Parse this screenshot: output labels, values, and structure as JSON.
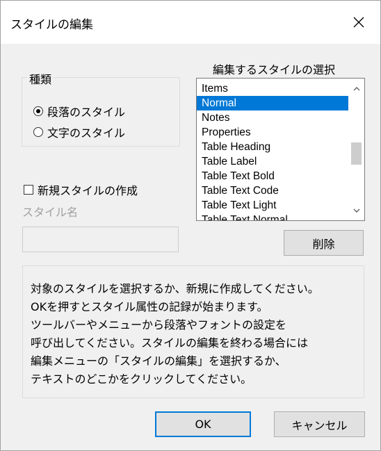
{
  "window": {
    "title": "スタイルの編集",
    "close_icon": "close-icon"
  },
  "kind_group": {
    "caption": "種類",
    "options": [
      {
        "label": "段落のスタイル",
        "checked": true
      },
      {
        "label": "文字のスタイル",
        "checked": false
      }
    ]
  },
  "new_style": {
    "checkbox_label": "新規スタイルの作成",
    "checked": false,
    "name_label": "スタイル名",
    "name_value": ""
  },
  "style_list": {
    "title": "編集するスタイルの選択",
    "items": [
      "Items",
      "Normal",
      "Notes",
      "Properties",
      "Table Heading",
      "Table Label",
      "Table Text Bold",
      "Table Text Code",
      "Table Text Light",
      "Table Text Normal"
    ],
    "selected": "Normal",
    "scroll_up_icon": "chevron-up-icon",
    "scroll_down_icon": "chevron-down-icon"
  },
  "buttons": {
    "delete": "削除",
    "ok": "OK",
    "cancel": "キャンセル"
  },
  "info": {
    "lines": [
      "対象のスタイルを選択するか、新規に作成してください。",
      "OKを押すとスタイル属性の記録が始まります。",
      "ツールバーやメニューから段落やフォントの設定を",
      "呼び出してください。スタイルの編集を終わる場合には",
      "編集メニューの「スタイルの編集」を選択するか、",
      "テキストのどこかをクリックしてください。"
    ]
  },
  "colors": {
    "selection": "#0078d7",
    "default_button_border": "#0078d7",
    "dialog_bg": "#f0f0f0"
  }
}
